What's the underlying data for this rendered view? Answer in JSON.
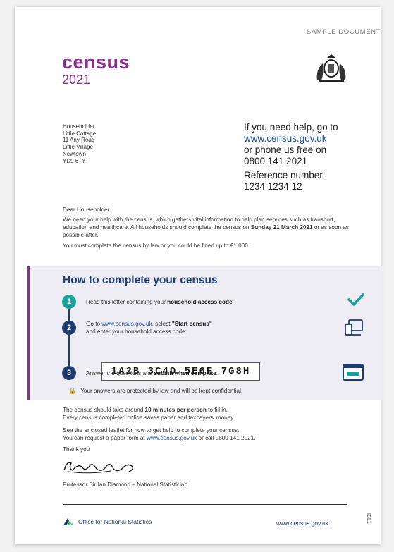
{
  "sample_label": "SAMPLE DOCUMENT",
  "logo": {
    "word": "census",
    "year": "2021"
  },
  "address": [
    "Householder",
    "Little Cottage",
    "11 Any Road",
    "Little Village",
    "Newtown",
    "YD9 6TY"
  ],
  "help": {
    "line1": "If you need help, go to",
    "website": "www.census.gov.uk",
    "line3": "or phone us free on",
    "phone": "0800 141 2021",
    "ref_label": "Reference number:",
    "ref_number": "1234 1234 12"
  },
  "letter": {
    "salutation": "Dear Householder",
    "para1_a": "We need your help with the census, which gathers vital information to help plan services such as transport, education and healthcare. All households should complete the census on ",
    "para1_bold": "Sunday 21 March 2021",
    "para1_b": " or as soon as possible after.",
    "para2": "You must complete the census by law or you could be fined up to £1,000."
  },
  "how_to": {
    "title": "How to complete your census",
    "step1_num": "1",
    "step1_a": "Read this letter containing your ",
    "step1_bold": "household access code",
    "step1_b": ".",
    "step2_num": "2",
    "step2_a": "Go to ",
    "step2_link": "www.census.gov.uk",
    "step2_b": ", select ",
    "step2_bold": "\"Start census\"",
    "step2_c": "and enter your household access code:",
    "access_code": "1A2B 3C4D 5E6F 7G8H",
    "step3_num": "3",
    "step3_a": "Answer the questions and ",
    "step3_bold": "submit when complete",
    "step3_b": ".",
    "protected": "Your answers are protected by law and will be kept confidential."
  },
  "closing": {
    "p1_a": "The census should take around ",
    "p1_bold": "10 minutes per person",
    "p1_b": " to fill in.",
    "p1_c": "Every census completed online saves paper and taxpayers' money.",
    "p2_a": "See the enclosed leaflet for how to get help to complete your census.",
    "p2_b": "You can request a paper form at ",
    "p2_link": "www.census.gov.uk",
    "p2_c": " or call 0800 141 2021.",
    "thanks": "Thank you",
    "signatory": "Professor Sir Ian Diamond – National Statistician"
  },
  "footer": {
    "ons_name": "Office for National Statistics",
    "url": "www.census.gov.uk",
    "doc_code": "ICL1"
  }
}
